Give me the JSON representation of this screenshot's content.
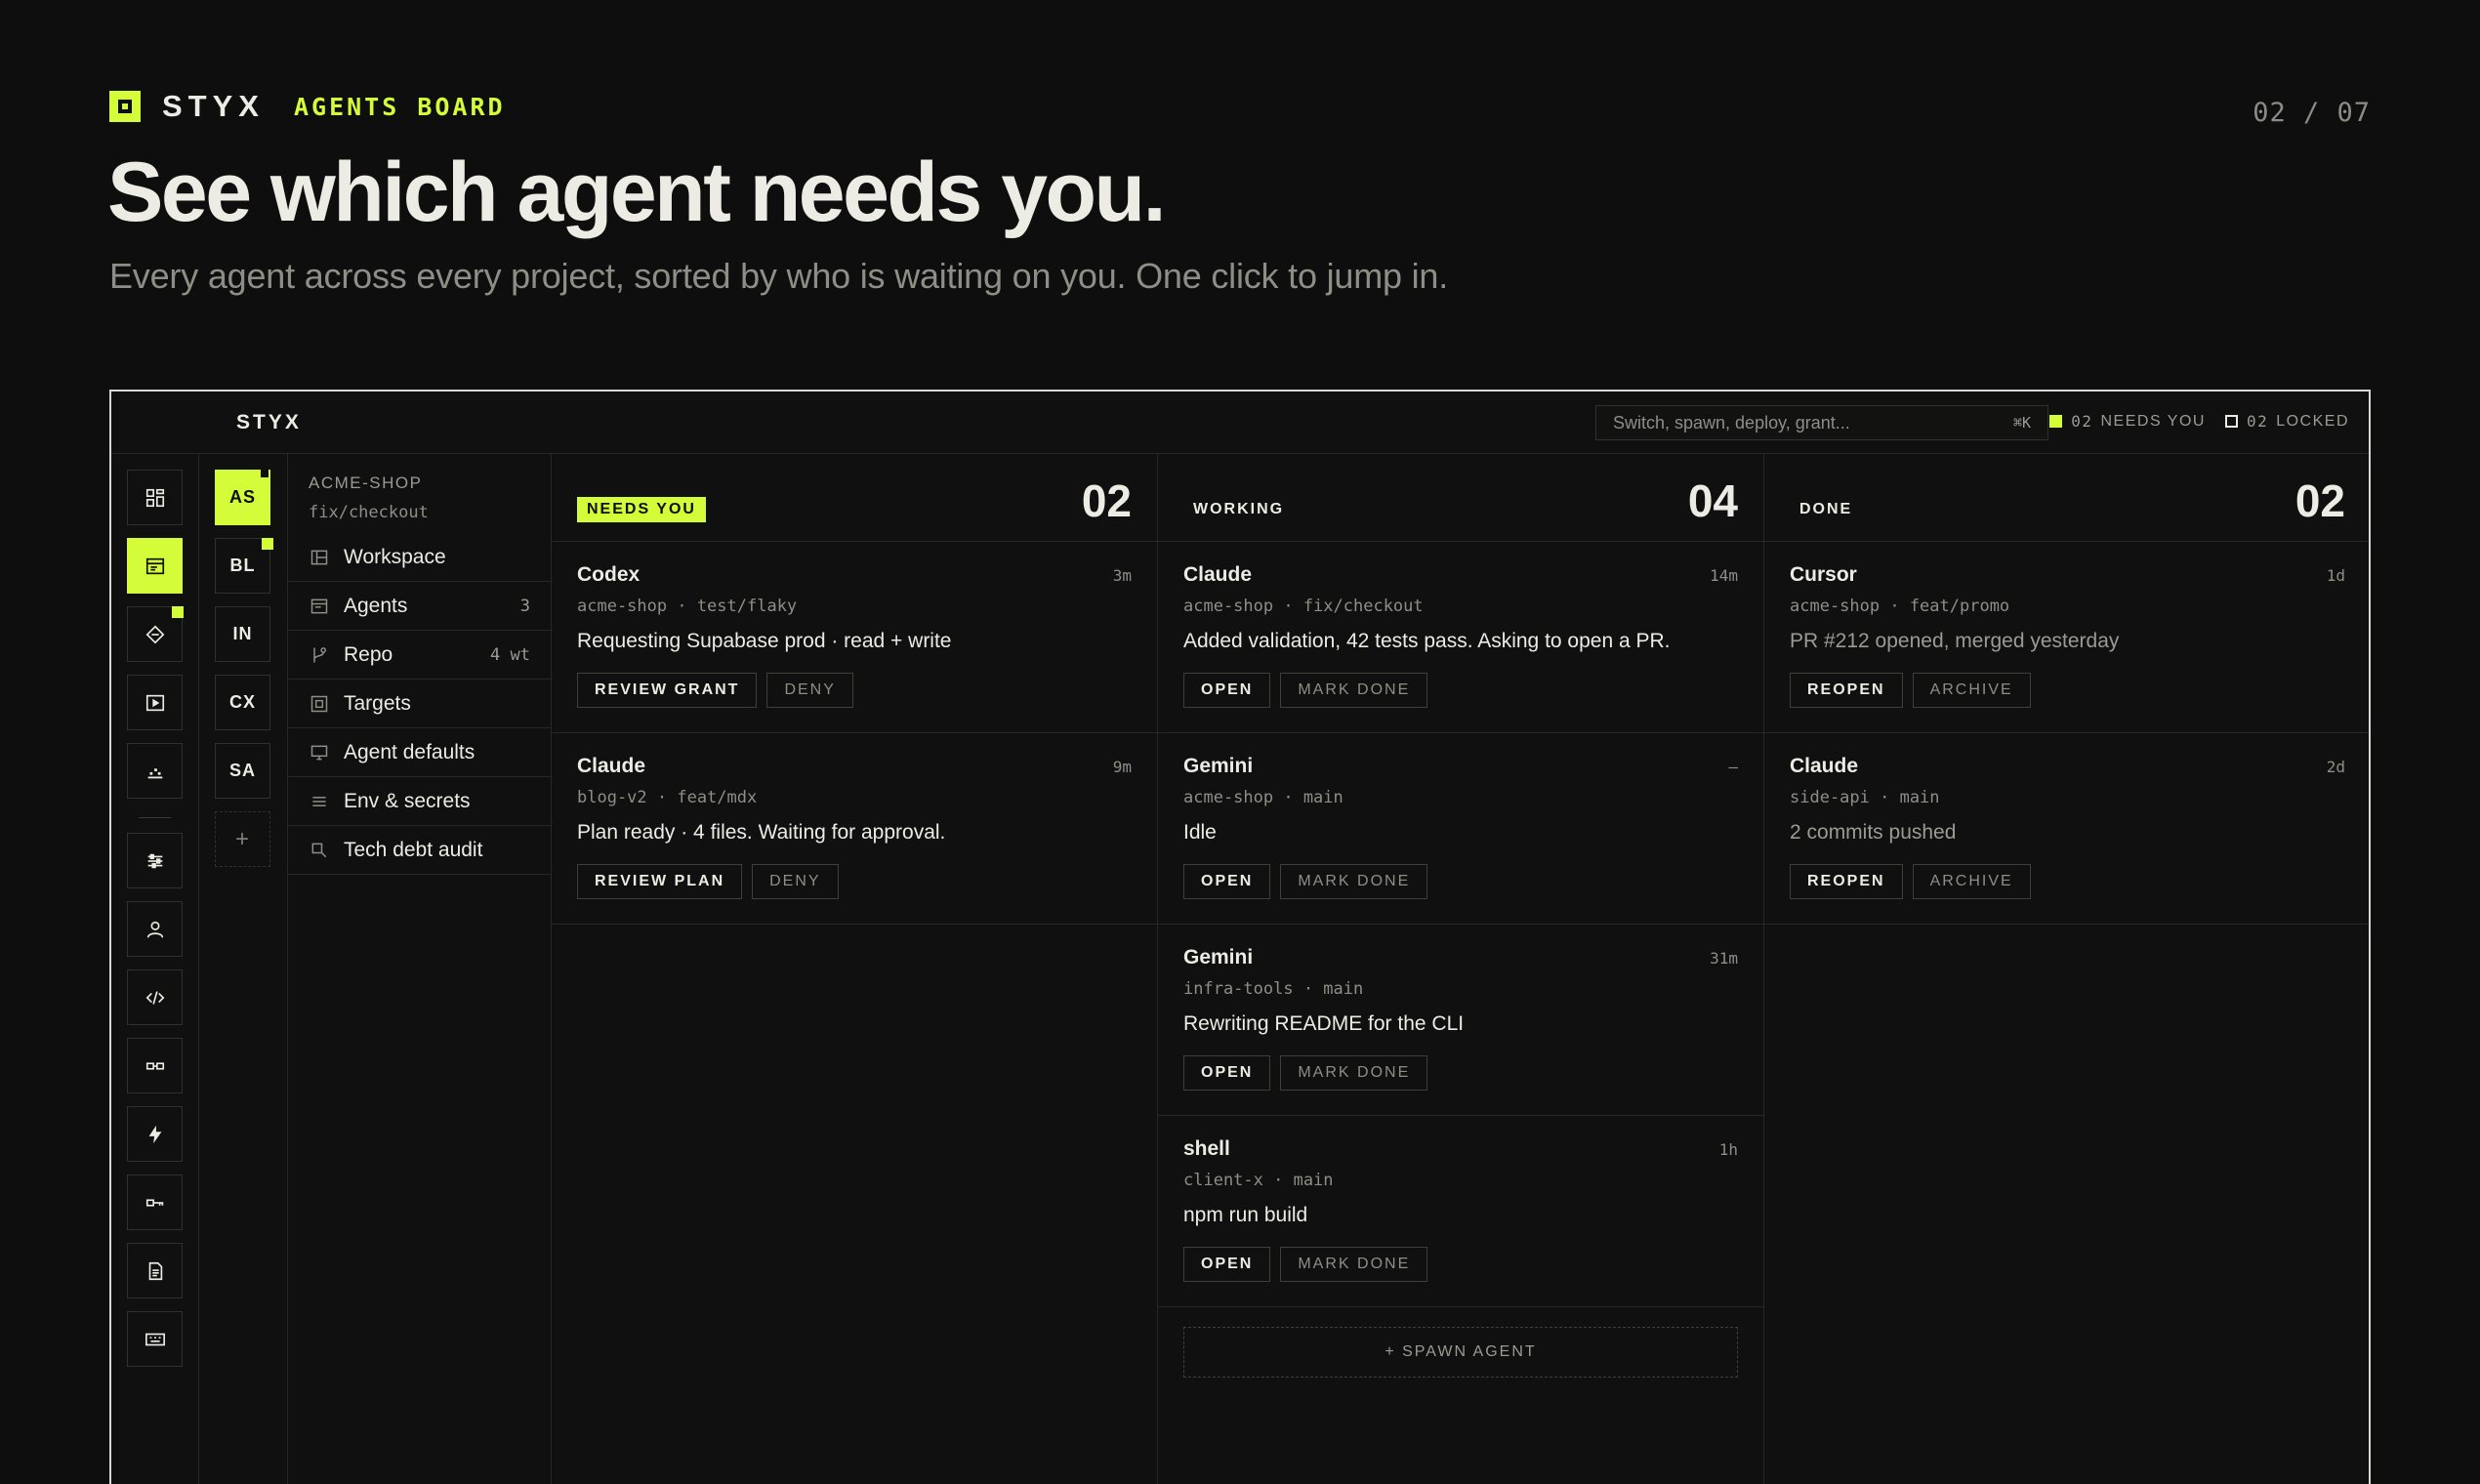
{
  "slide": {
    "brand": "STYX",
    "section": "AGENTS BOARD",
    "page_counter": "02 / 07",
    "title": "See which agent needs you.",
    "subtitle": "Every agent across every project, sorted by who is waiting on you. One click to jump in."
  },
  "app": {
    "brand": "STYX",
    "search": {
      "placeholder": "Switch, spawn, deploy, grant...",
      "shortcut": "⌘K"
    },
    "status": {
      "needs_you": {
        "count": "02",
        "label": "NEEDS YOU"
      },
      "locked": {
        "count": "02",
        "label": "LOCKED"
      }
    },
    "accent": "#d4fc38",
    "rail_icons": [
      "grid-icon",
      "board-icon",
      "diamond-icon",
      "play-icon",
      "chart-icon",
      "sliders-icon",
      "user-icon",
      "code-icon",
      "link-icon",
      "bolt-icon",
      "key-icon",
      "document-icon",
      "keyboard-icon"
    ],
    "projects": [
      "AS",
      "BL",
      "IN",
      "CX",
      "SA"
    ],
    "add_project": "+",
    "sidebar": {
      "project": "ACME-SHOP",
      "branch": "fix/checkout",
      "items": [
        {
          "label": "Workspace",
          "icon": "layout-icon",
          "count": ""
        },
        {
          "label": "Agents",
          "icon": "terminal-icon",
          "count": "3"
        },
        {
          "label": "Repo",
          "icon": "branch-icon",
          "count": "4 wt"
        },
        {
          "label": "Targets",
          "icon": "target-icon",
          "count": ""
        },
        {
          "label": "Agent defaults",
          "icon": "monitor-icon",
          "count": ""
        },
        {
          "label": "Env & secrets",
          "icon": "list-icon",
          "count": ""
        },
        {
          "label": "Tech debt audit",
          "icon": "magnifier-icon",
          "count": ""
        }
      ]
    },
    "columns": [
      {
        "tag": "NEEDS YOU",
        "count": "02",
        "cards": [
          {
            "agent": "Codex",
            "age": "3m",
            "repo": "acme-shop · test/flaky",
            "message": "Requesting Supabase prod · read + write",
            "primary": "REVIEW GRANT",
            "secondary": "DENY"
          },
          {
            "agent": "Claude",
            "age": "9m",
            "repo": "blog-v2 · feat/mdx",
            "message": "Plan ready · 4 files. Waiting for approval.",
            "primary": "REVIEW PLAN",
            "secondary": "DENY"
          }
        ]
      },
      {
        "tag": "WORKING",
        "count": "04",
        "cards": [
          {
            "agent": "Claude",
            "age": "14m",
            "repo": "acme-shop · fix/checkout",
            "message": "Added validation, 42 tests pass. Asking to open a PR.",
            "primary": "OPEN",
            "secondary": "MARK DONE"
          },
          {
            "agent": "Gemini",
            "age": "–",
            "repo": "acme-shop · main",
            "message": "Idle",
            "primary": "OPEN",
            "secondary": "MARK DONE"
          },
          {
            "agent": "Gemini",
            "age": "31m",
            "repo": "infra-tools · main",
            "message": "Rewriting README for the CLI",
            "primary": "OPEN",
            "secondary": "MARK DONE"
          },
          {
            "agent": "shell",
            "age": "1h",
            "repo": "client-x · main",
            "message": "npm run build",
            "primary": "OPEN",
            "secondary": "MARK DONE"
          }
        ],
        "spawn": "+ SPAWN AGENT"
      },
      {
        "tag": "DONE",
        "count": "02",
        "cards": [
          {
            "agent": "Cursor",
            "age": "1d",
            "repo": "acme-shop · feat/promo",
            "message": "PR #212 opened, merged yesterday",
            "primary": "REOPEN",
            "secondary": "ARCHIVE"
          },
          {
            "agent": "Claude",
            "age": "2d",
            "repo": "side-api · main",
            "message": "2 commits pushed",
            "primary": "REOPEN",
            "secondary": "ARCHIVE"
          }
        ]
      }
    ]
  }
}
